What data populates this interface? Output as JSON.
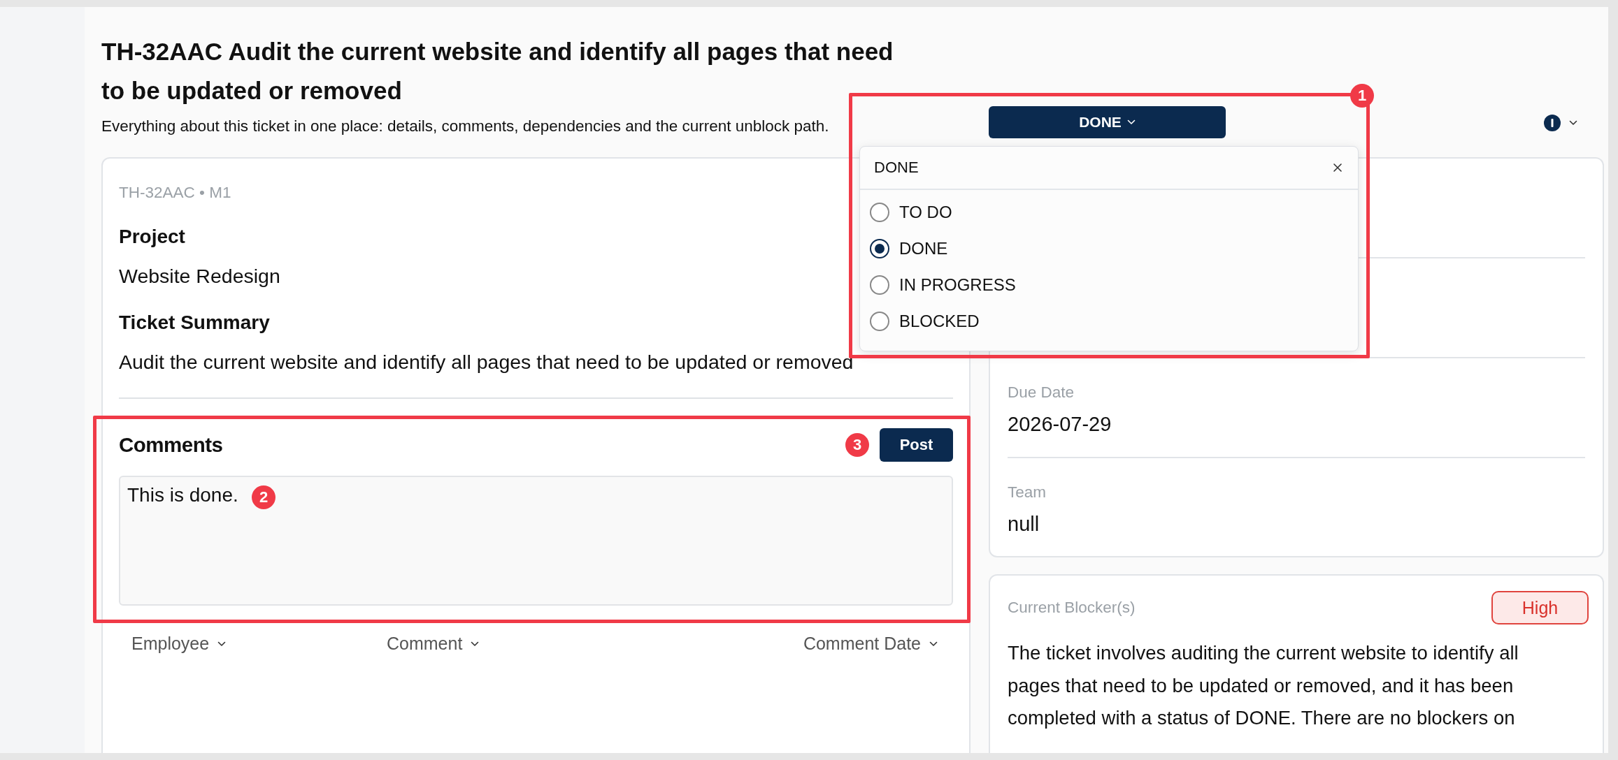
{
  "header": {
    "title": "TH-32AAC Audit the current website and identify all pages that need to be updated or removed",
    "subtitle": "Everything about this ticket in one place: details, comments, dependencies and the current unblock path."
  },
  "status_button": {
    "label": "DONE"
  },
  "status_dropdown": {
    "search_value": "DONE",
    "options": [
      {
        "label": "TO DO",
        "selected": false
      },
      {
        "label": "DONE",
        "selected": true
      },
      {
        "label": "IN PROGRESS",
        "selected": false
      },
      {
        "label": "BLOCKED",
        "selected": false
      }
    ]
  },
  "ticket": {
    "meta": "TH-32AAC • M1",
    "fields": [
      {
        "label": "Project",
        "value": "Website Redesign"
      },
      {
        "label": "Ticket Summary",
        "value": "Audit the current website and identify all pages that need to be updated or removed"
      }
    ]
  },
  "comments": {
    "title": "Comments",
    "post_button": "Post",
    "input_value": "This is done.",
    "columns": [
      "Employee",
      "Comment",
      "Comment Date"
    ]
  },
  "details": {
    "fields": [
      {
        "label": "Due Date",
        "value": "2026-07-29"
      },
      {
        "label": "Team",
        "value": "null"
      }
    ]
  },
  "blocker": {
    "label": "Current Blocker(s)",
    "priority": "High",
    "text": "The ticket involves auditing the current website to identify all pages that need to be updated or removed, and it has been completed with a status of DONE. There are no blockers on"
  },
  "annotations": [
    {
      "number": "1"
    },
    {
      "number": "2"
    },
    {
      "number": "3"
    }
  ]
}
